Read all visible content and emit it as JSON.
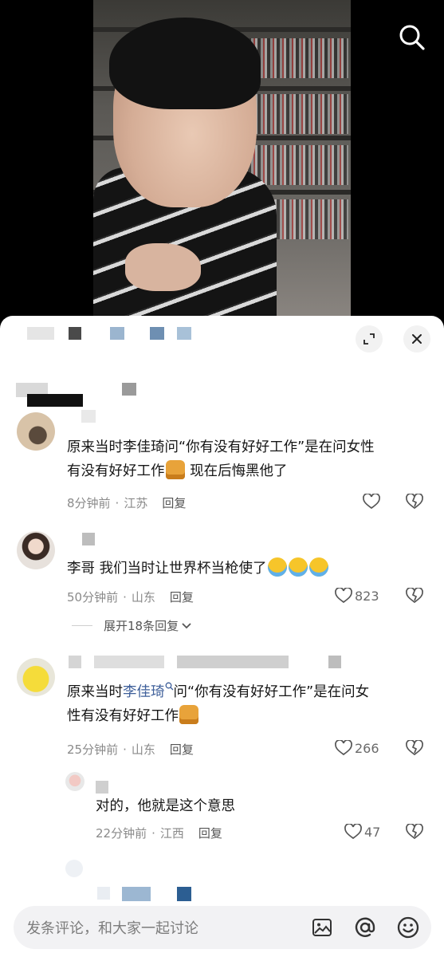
{
  "video": {
    "search_icon": "search-icon"
  },
  "panel": {
    "expand_icon": "expand-icon",
    "close_icon": "close-icon",
    "colors": {
      "link": "#3e5f9a",
      "meta": "#8a8a8a",
      "text": "#161616"
    }
  },
  "comments": [
    {
      "text_line1": "原来当时李佳琦问“你有没有好好工作”是在问女性",
      "text_line2": "有没有好好工作",
      "text_line2_after": " 现在后悔黑他了",
      "time": "8分钟前",
      "location": "江苏",
      "reply_label": "回复",
      "likes": ""
    },
    {
      "text": "李哥 我们当时让世界杯当枪使了",
      "time": "50分钟前",
      "location": "山东",
      "reply_label": "回复",
      "likes": "823"
    },
    {
      "text_line1_a": "原来当时",
      "mention": "李佳琦",
      "text_line1_b": "问“你有没有好好工作”是在问女",
      "text_line2": "性有没有好好工作",
      "time": "25分钟前",
      "location": "山东",
      "reply_label": "回复",
      "likes": "266"
    },
    {
      "text": "对的，他就是这个意思",
      "time": "22分钟前",
      "location": "江西",
      "reply_label": "回复",
      "likes": "47"
    }
  ],
  "expand_replies": "展开18条回复",
  "input": {
    "placeholder": "发条评论，和大家一起讨论",
    "icons": [
      "image-icon",
      "at-icon",
      "emoji-icon"
    ]
  }
}
